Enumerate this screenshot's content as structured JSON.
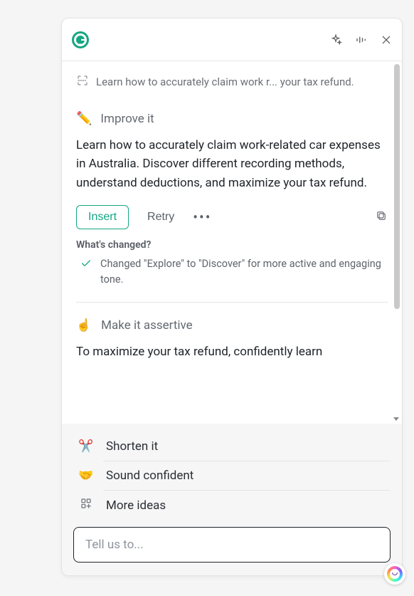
{
  "original_truncated": "Learn how to accurately claim work r... your tax refund.",
  "improve": {
    "title": "Improve it",
    "emoji": "✏️",
    "body": "Learn how to accurately claim work-related car expenses in Australia. Discover different recording methods, understand deductions, and maximize your tax refund.",
    "insert_label": "Insert",
    "retry_label": "Retry",
    "changed_heading": "What's changed?",
    "changed_text": "Changed \"Explore\" to \"Discover\" for more active and engaging tone."
  },
  "assertive": {
    "emoji": "☝️",
    "title": "Make it assertive",
    "body": "To maximize your tax refund, confidently learn"
  },
  "quick_actions": {
    "shorten": {
      "emoji": "✂️",
      "label": "Shorten it"
    },
    "confident": {
      "emoji": "🤝",
      "label": "Sound confident"
    },
    "more": {
      "label": "More ideas"
    }
  },
  "input_placeholder": "Tell us to..."
}
